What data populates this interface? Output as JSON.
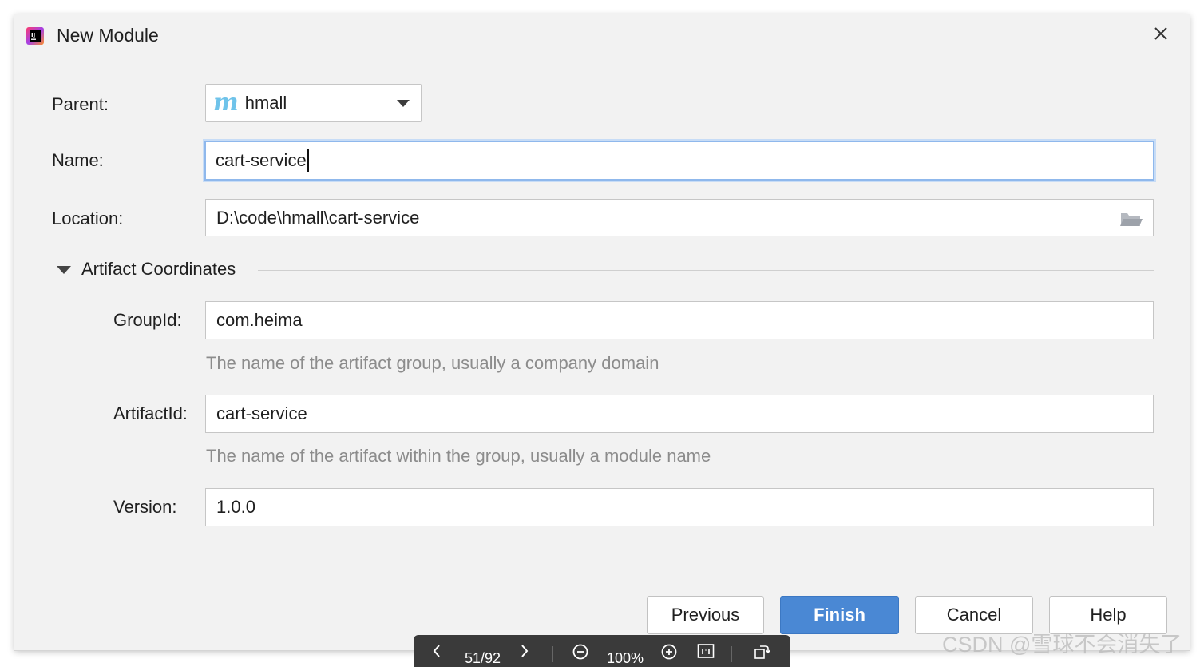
{
  "dialog": {
    "title": "New Module",
    "close_icon": "close-icon",
    "app_icon": "intellij-idea-icon"
  },
  "form": {
    "parent_label": "Parent:",
    "parent_value": "hmall",
    "parent_icon": "maven-module-icon",
    "name_label": "Name:",
    "name_value": "cart-service",
    "location_label": "Location:",
    "location_value": "D:\\code\\hmall\\cart-service",
    "location_icon": "folder-icon"
  },
  "artifact": {
    "section_title": "Artifact Coordinates",
    "section_expanded": true,
    "groupid_label": "GroupId:",
    "groupid_value": "com.heima",
    "groupid_hint": "The name of the artifact group, usually a company domain",
    "artifactid_label": "ArtifactId:",
    "artifactid_value": "cart-service",
    "artifactid_hint": "The name of the artifact within the group, usually a module name",
    "version_label": "Version:",
    "version_value": "1.0.0"
  },
  "buttons": {
    "previous": "Previous",
    "finish": "Finish",
    "cancel": "Cancel",
    "help": "Help"
  },
  "viewer": {
    "page": "51/92",
    "zoom": "100%"
  },
  "watermark": "CSDN @雪球不会消失了",
  "colors": {
    "accent": "#4a88d4",
    "focus_ring": "#8fb8ec",
    "maven_icon": "#6fc3ea"
  }
}
